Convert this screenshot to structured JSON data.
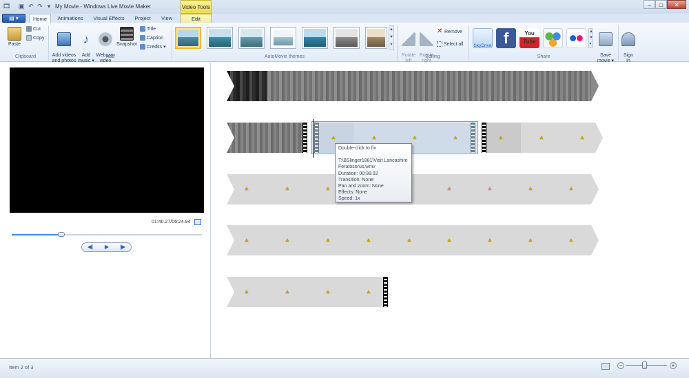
{
  "window": {
    "title": "My Movie - Windows Live Movie Maker",
    "context_tab": "Video Tools",
    "controls": {
      "minimize": "–",
      "maximize": "□",
      "close": "✕"
    }
  },
  "quick_access": {
    "save_icon": "floppy-icon",
    "undo_icon": "undo-icon",
    "redo_icon": "redo-icon",
    "customize": "▾"
  },
  "tabs": [
    {
      "label": "Home"
    },
    {
      "label": "Animations"
    },
    {
      "label": "Visual Effects"
    },
    {
      "label": "Project"
    },
    {
      "label": "View"
    },
    {
      "label": "Edit"
    }
  ],
  "ribbon": {
    "clipboard": {
      "label": "Clipboard",
      "paste": "Paste",
      "cut": "Cut",
      "copy": "Copy"
    },
    "add": {
      "label": "Add",
      "add_videos": "Add videos\nand photos",
      "add_music": "Add\nmusic ▾",
      "webcam": "Webcam\nvideo",
      "snapshot": "Snapshot",
      "title": "Title",
      "caption": "Caption",
      "credits": "Credits ▾"
    },
    "themes": {
      "label": "AutoMovie themes"
    },
    "editing": {
      "label": "Editing",
      "rotate_left": "Rotate\nleft",
      "rotate_right": "Rotate\nright",
      "remove": "Remove",
      "select_all": "Select all"
    },
    "share": {
      "label": "Share",
      "skydrive": "SkyDrive",
      "youtube": "You\nTube",
      "save_movie": "Save\nmovie ▾",
      "sign_in": "Sign\nin"
    }
  },
  "player": {
    "timecode": "01:40.27/06:24.94",
    "progress": 0.26,
    "prev": "◀|",
    "play": "▶",
    "next": "|▶"
  },
  "tooltip": {
    "line1": "Double-click to fix",
    "line2": "T:\\BSlinger1881\\Visit Lancashire",
    "line3": "Feratosorus.wmv",
    "line4": "Duration: 00:38.02",
    "line5": "Transition: None",
    "line6": "Pan and zoom: None",
    "line7": "Effects: None",
    "line8": "Speed: 1x"
  },
  "status": {
    "item": "Item 2 of 3"
  },
  "colors": {
    "accent": "#3a8ee6",
    "warning": "#d4a400",
    "ribbon": "#e3ecf7"
  }
}
